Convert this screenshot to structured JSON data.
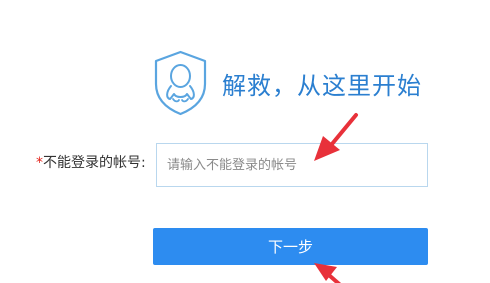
{
  "header": {
    "title": "解救，从这里开始",
    "logo_icon": "qq-shield-icon",
    "accent_color": "#2b7fd0"
  },
  "form": {
    "required_mark": "*",
    "account_label": "不能登录的帐号:",
    "account_placeholder": "请输入不能登录的帐号",
    "account_value": ""
  },
  "actions": {
    "next_label": "下一步",
    "button_color": "#2d8cf0"
  },
  "annotations": {
    "arrow_color": "#e8313a",
    "arrow_icons": [
      "annotation-arrow-icon",
      "annotation-arrow-icon"
    ]
  }
}
